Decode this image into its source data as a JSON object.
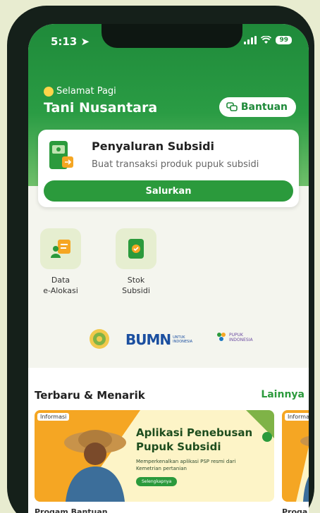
{
  "status": {
    "time": "5:13",
    "battery": "99"
  },
  "header": {
    "greeting": "Selamat Pagi",
    "user": "Tani Nusantara",
    "help_label": "Bantuan"
  },
  "subsidy_card": {
    "title": "Penyaluran Subsidi",
    "subtitle": "Buat transaksi produk pupuk subsidi",
    "button_label": "Salurkan"
  },
  "menu": [
    {
      "label_line1": "Data",
      "label_line2": "e-Alokasi"
    },
    {
      "label_line1": "Stok",
      "label_line2": "Subsidi"
    }
  ],
  "logos": {
    "bumn_text": "BUMN",
    "bumn_sub": "UNTUK INDONESIA",
    "pupuk_text": "PUPUK INDONESIA"
  },
  "section": {
    "title": "Terbaru & Menarik",
    "more_label": "Lainnya",
    "banners": [
      {
        "tag": "Informasi",
        "title": "Aplikasi Penebusan Pupuk Subsidi",
        "description": "Memperkenalkan aplikasi PSP resmi dari Kemetrian pertanian",
        "button": "Selengkapnya",
        "caption": "Progam Bantuan"
      },
      {
        "tag": "Informasi",
        "caption": "Proga"
      }
    ]
  },
  "colors": {
    "primary": "#2b9a3c",
    "header_green": "#1f8a3a"
  }
}
